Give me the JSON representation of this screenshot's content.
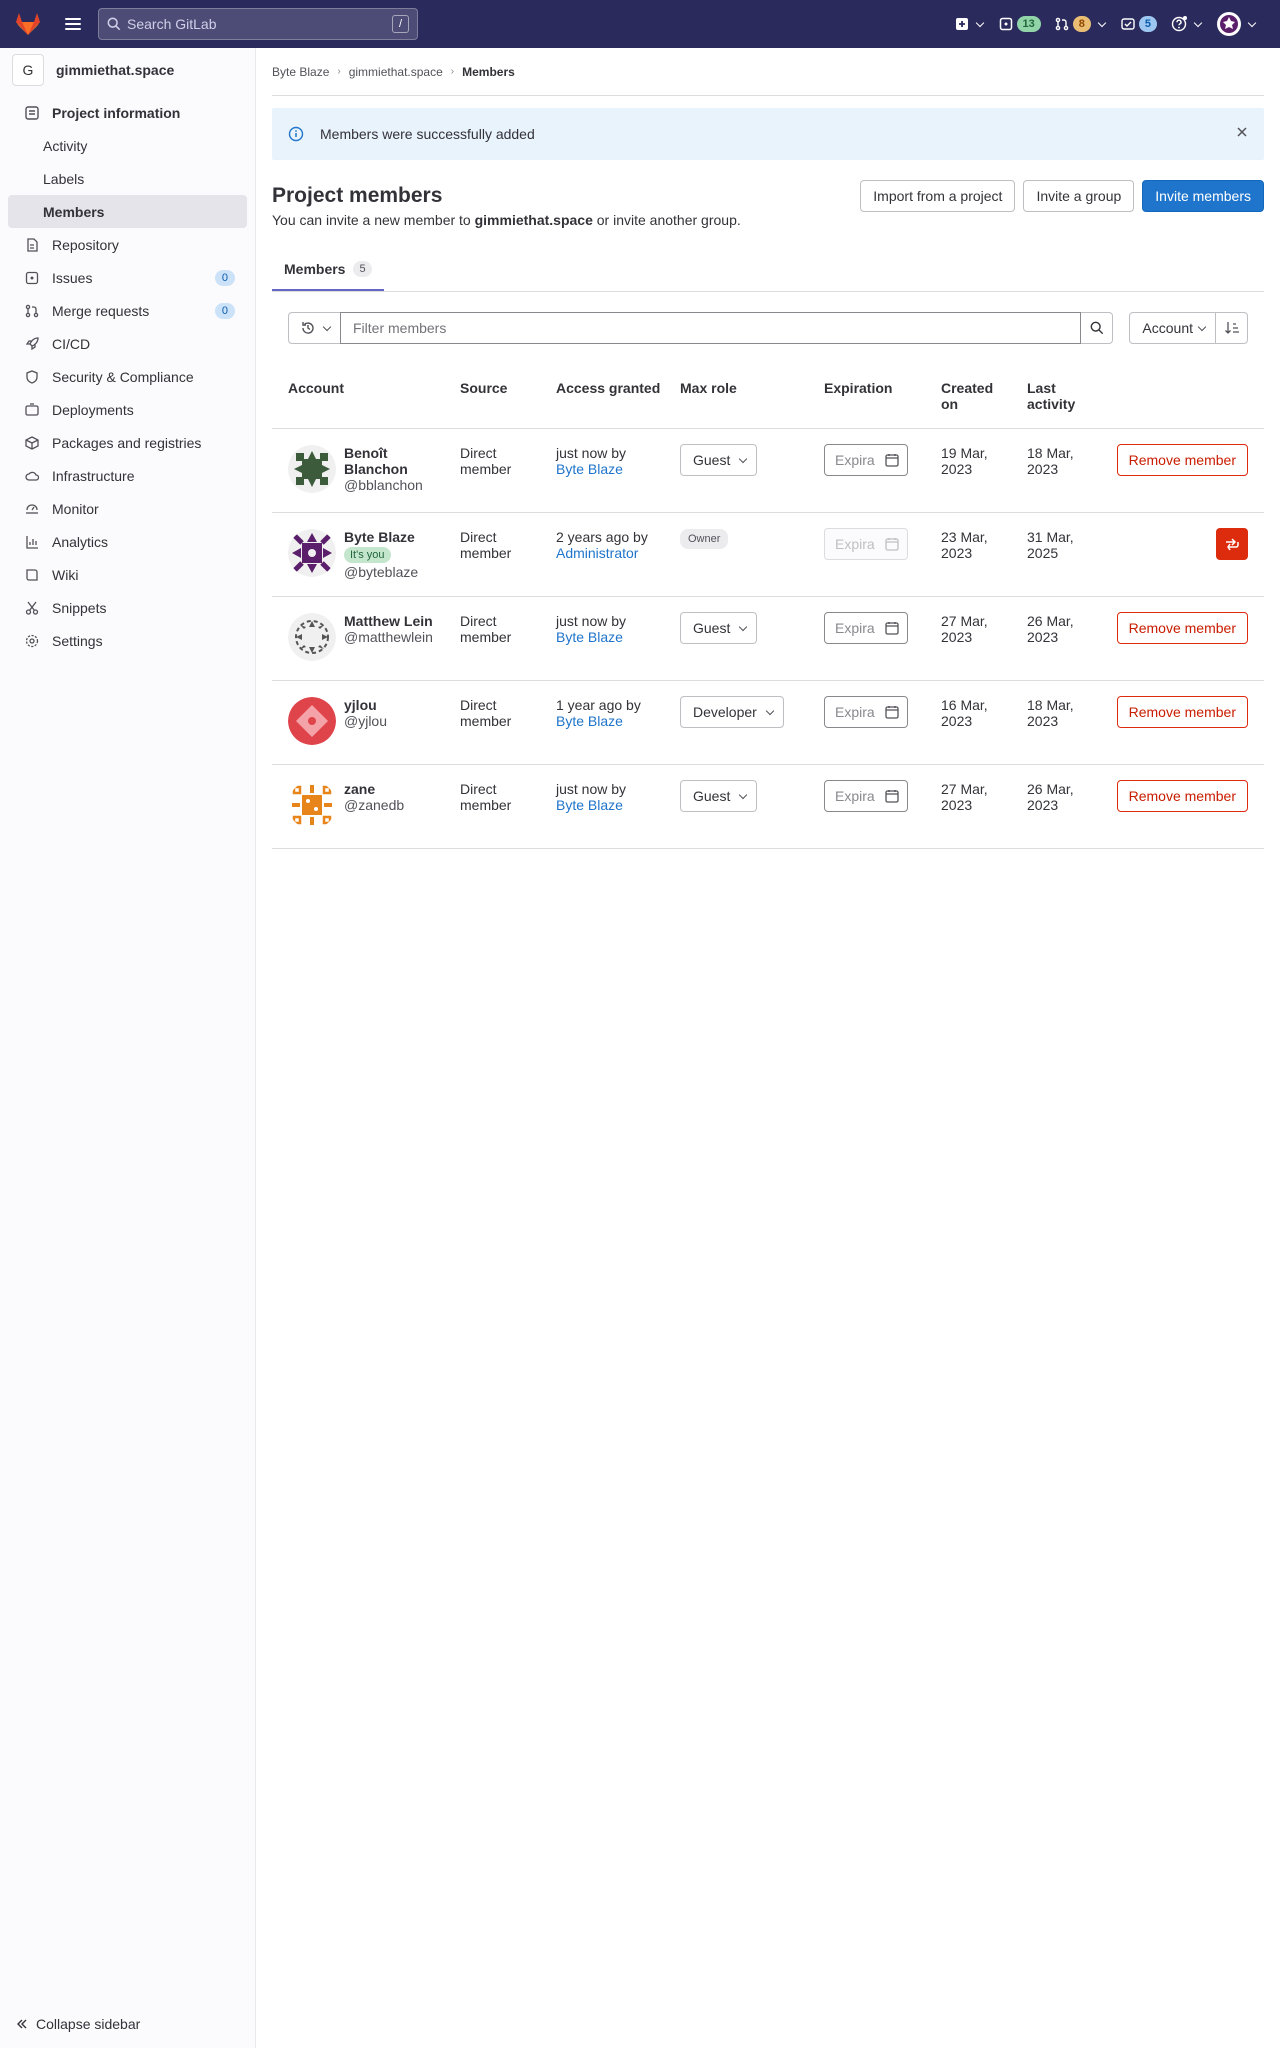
{
  "topbar": {
    "search_placeholder": "Search GitLab",
    "search_shortcut": "/",
    "issues_count": "13",
    "mr_count": "8",
    "todos_count": "5"
  },
  "sidebar": {
    "project_initial": "G",
    "project_name": "gimmiethat.space",
    "items": [
      {
        "label": "Project information"
      },
      {
        "label": "Activity"
      },
      {
        "label": "Labels"
      },
      {
        "label": "Members"
      },
      {
        "label": "Repository"
      },
      {
        "label": "Issues",
        "count": "0"
      },
      {
        "label": "Merge requests",
        "count": "0"
      },
      {
        "label": "CI/CD"
      },
      {
        "label": "Security & Compliance"
      },
      {
        "label": "Deployments"
      },
      {
        "label": "Packages and registries"
      },
      {
        "label": "Infrastructure"
      },
      {
        "label": "Monitor"
      },
      {
        "label": "Analytics"
      },
      {
        "label": "Wiki"
      },
      {
        "label": "Snippets"
      },
      {
        "label": "Settings"
      }
    ],
    "collapse_label": "Collapse sidebar"
  },
  "breadcrumb": [
    "Byte Blaze",
    "gimmiethat.space",
    "Members"
  ],
  "alert": {
    "message": "Members were successfully added"
  },
  "page": {
    "title": "Project members",
    "import_btn": "Import from a project",
    "invite_group_btn": "Invite a group",
    "invite_members_btn": "Invite members",
    "subtitle_pre": "You can invite a new member to ",
    "subtitle_project": "gimmiethat.space",
    "subtitle_post": " or invite another group."
  },
  "tabs": [
    {
      "label": "Members",
      "count": "5"
    }
  ],
  "filter": {
    "placeholder": "Filter members",
    "sort_label": "Account"
  },
  "table": {
    "headers": {
      "account": "Account",
      "source": "Source",
      "access": "Access granted",
      "role": "Max role",
      "expiration": "Expiration",
      "created": "Created on",
      "activity": "Last activity"
    },
    "rows": [
      {
        "name": "Benoît Blanchon",
        "username": "@bblanchon",
        "source": "Direct member",
        "access": "just now by",
        "granted_by": "Byte Blaze",
        "role": "Guest",
        "expiration": "Expira",
        "created": "19 Mar, 2023",
        "activity": "18 Mar, 2023",
        "action": "Remove member"
      },
      {
        "name": "Byte Blaze",
        "you_badge": "It's you",
        "username": "@byteblaze",
        "source": "Direct member",
        "access": "2 years ago by",
        "granted_by": "Administrator",
        "role": "Owner",
        "expiration": "Expira",
        "created": "23 Mar, 2023",
        "activity": "31 Mar, 2025"
      },
      {
        "name": "Matthew Lein",
        "username": "@matthewlein",
        "source": "Direct member",
        "access": "just now by",
        "granted_by": "Byte Blaze",
        "role": "Guest",
        "expiration": "Expira",
        "created": "27 Mar, 2023",
        "activity": "26 Mar, 2023",
        "action": "Remove member"
      },
      {
        "name": "yjlou",
        "username": "@yjlou",
        "source": "Direct member",
        "access": "1 year ago by",
        "granted_by": "Byte Blaze",
        "role": "Developer",
        "expiration": "Expira",
        "created": "16 Mar, 2023",
        "activity": "18 Mar, 2023",
        "action": "Remove member"
      },
      {
        "name": "zane",
        "username": "@zanedb",
        "source": "Direct member",
        "access": "just now by",
        "granted_by": "Byte Blaze",
        "role": "Guest",
        "expiration": "Expira",
        "created": "27 Mar, 2023",
        "activity": "26 Mar, 2023",
        "action": "Remove member"
      }
    ]
  },
  "colors": {
    "topbar": "#2b2a5c",
    "primary": "#1f75cb",
    "danger": "#dd2b0e",
    "avatar_benoit": "#3b5b3b",
    "avatar_byte": "#5a1e6b",
    "avatar_matthew": "#555555",
    "avatar_yjlou": "#e0444b",
    "avatar_zane": "#e8851a"
  },
  "icons": {
    "logo": "gitlab-tanuki-icon",
    "search": "search-icon",
    "new": "plus-square-icon",
    "issues": "issues-icon",
    "merge_requests": "merge-request-icon",
    "todos": "todo-done-icon",
    "help": "question-icon",
    "alert": "information-icon",
    "calendar": "calendar-icon",
    "leave": "leave-icon"
  }
}
